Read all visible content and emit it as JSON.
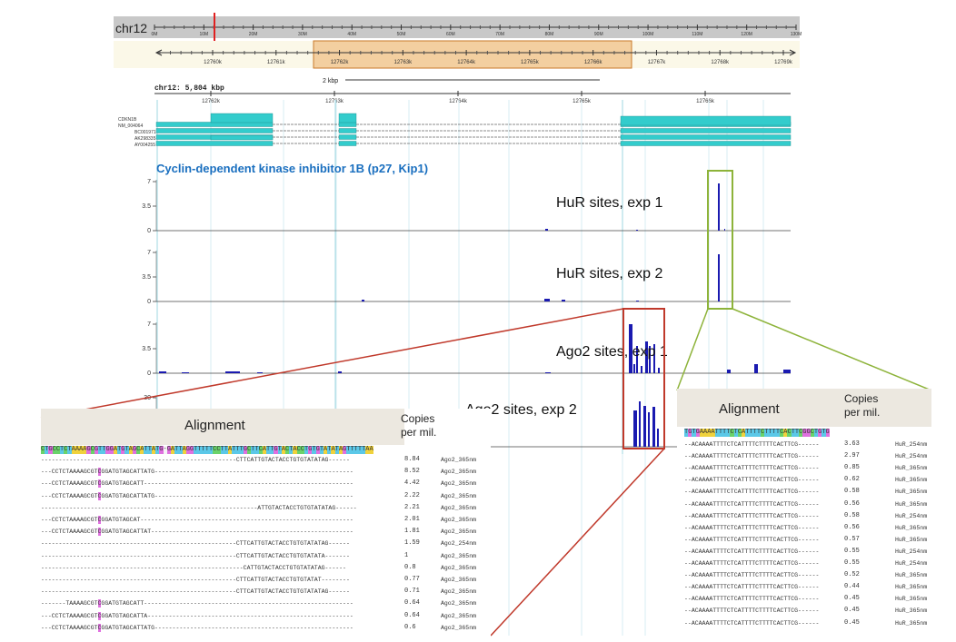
{
  "ideogram": {
    "chrom": "chr12",
    "ticks": [
      "0M",
      "10M",
      "20M",
      "30M",
      "40M",
      "50M",
      "60M",
      "70M",
      "80M",
      "90M",
      "100M",
      "110M",
      "120M",
      "130M"
    ]
  },
  "zoom_axis": {
    "ticks": [
      "12760k",
      "12761k",
      "12762k",
      "12763k",
      "12764k",
      "12765k",
      "12766k",
      "12767k",
      "12768k",
      "12769k"
    ]
  },
  "detail_axis": {
    "scale_label": "2 kbp",
    "region_label": "chr12: 5,804 kbp",
    "ticks": [
      "12762k",
      "12763k",
      "12764k",
      "12765k",
      "12766k"
    ]
  },
  "transcripts": [
    "CDKN1B",
    "NM_004064",
    "BC001971",
    "AK298335",
    "AY004255"
  ],
  "gene_title": "Cyclin-dependent kinase inhibitor 1B (p27, Kip1)",
  "tracks": [
    {
      "label": "HuR sites, exp 1",
      "ticks": [
        "7",
        "3.5",
        "0"
      ]
    },
    {
      "label": "HuR sites, exp 2",
      "ticks": [
        "7",
        "3.5",
        "0"
      ]
    },
    {
      "label": "Ago2 sites, exp 1",
      "ticks": [
        "7",
        "3.5",
        "0"
      ]
    },
    {
      "label": "Ago2 sites, exp 2",
      "ticks": [
        "30"
      ]
    }
  ],
  "left_alignment": {
    "title": "Alignment",
    "copies_label_1": "Copies",
    "copies_label_2": "per mil.",
    "reference": "CTGCCTCTAAAAGCGTTGGATGTAGCATTATG-GATTAGGTTTTTCCTTATTTGCTTCATTGTACTACCTGTGTATATAGTTTTTAA",
    "rows": [
      {
        "seq": "-------------------------------------------------------CTTCATTGTACTACCTGTGTATATAG------",
        "copies": "8.84",
        "lib": "Ago2_365nm"
      },
      {
        "seq": "---CCTCTAAAAGCGTCGGATGTAGCATTATG--------------------------------------------------------",
        "copies": "8.52",
        "lib": "Ago2_365nm"
      },
      {
        "seq": "---CCTCTAAAAGCGTCGGATGTAGCATT-----------------------------------------------------------",
        "copies": "4.42",
        "lib": "Ago2_365nm"
      },
      {
        "seq": "---CCTCTAAAAGCGTCGGATGTAGCATTATG--------------------------------------------------------",
        "copies": "2.22",
        "lib": "Ago2_365nm"
      },
      {
        "seq": "-------------------------------------------------------------ATTGTACTACCTGTGTATATAG------",
        "copies": "2.21",
        "lib": "Ago2_365nm"
      },
      {
        "seq": "---CCTCTAAAAGCGTCGGATGTAGCAT------------------------------------------------------------",
        "copies": "2.01",
        "lib": "Ago2_365nm"
      },
      {
        "seq": "---CCTCTAAAAGCGTCGGATGTAGCATTAT---------------------------------------------------------",
        "copies": "1.81",
        "lib": "Ago2_365nm"
      },
      {
        "seq": "-------------------------------------------------------CTTCATTGTACTACCTGTGTATATAG------",
        "copies": "1.59",
        "lib": "Ago2_254nm"
      },
      {
        "seq": "-------------------------------------------------------CTTCATTGTACTACCTGTGTATATA-------",
        "copies": "1",
        "lib": "Ago2_365nm"
      },
      {
        "seq": "---------------------------------------------------------CATTGTACTACCTGTGTATATAG------",
        "copies": "0.8",
        "lib": "Ago2_365nm"
      },
      {
        "seq": "-------------------------------------------------------CTTCATTGTACTACCTGTGTATAT--------",
        "copies": "0.77",
        "lib": "Ago2_365nm"
      },
      {
        "seq": "-------------------------------------------------------CTTCATTGTACTACCTGTGTATATAG------",
        "copies": "0.71",
        "lib": "Ago2_365nm"
      },
      {
        "seq": "-------TAAAAGCGTCGGATGTAGCATT-----------------------------------------------------------",
        "copies": "0.64",
        "lib": "Ago2_365nm"
      },
      {
        "seq": "---CCTCTAAAAGCGTCGGATGTAGCATTA----------------------------------------------------------",
        "copies": "0.64",
        "lib": "Ago2_365nm"
      },
      {
        "seq": "---CCTCTAAAAGCGTCGGATGTAGCATTATG--------------------------------------------------------",
        "copies": "0.6",
        "lib": "Ago2_365nm"
      }
    ]
  },
  "right_alignment": {
    "title": "Alignment",
    "copies_label_1": "Copies",
    "copies_label_2": "per mil.",
    "reference": "TGTGAAAATTTTCTCATTTTCTTTTCACTTCGGCTGTG",
    "rows": [
      {
        "seq": "--ACAAAATTTTCTCATTTTCTTTTCACTTCG------",
        "copies": "3.63",
        "lib": "HuR_254nm"
      },
      {
        "seq": "--ACAAAATTTTCTCATTTTCTTTTCACTTCG------",
        "copies": "2.97",
        "lib": "HuR_254nm"
      },
      {
        "seq": "--ACAAAATTTTCTCATTTTCTTTTCACTTCG------",
        "copies": "0.85",
        "lib": "HuR_365nm"
      },
      {
        "seq": "--ACAAAATTTTCTCATTTTCTTTTCACTTCG------",
        "copies": "0.62",
        "lib": "HuR_365nm"
      },
      {
        "seq": "--ACAAAATTTTCTCATTTTCTTTTCACTTCG------",
        "copies": "0.58",
        "lib": "HuR_365nm"
      },
      {
        "seq": "--ACAAAATTTTCTCATTTTCTTTTCACTTCG------",
        "copies": "0.56",
        "lib": "HuR_365nm"
      },
      {
        "seq": "--ACAAAATTTTCTCATTTTCTTTTCACTTCG------",
        "copies": "0.58",
        "lib": "HuR_254nm"
      },
      {
        "seq": "--ACAAAATTTTCTCATTTTCTTTTCACTTCG------",
        "copies": "0.56",
        "lib": "HuR_365nm"
      },
      {
        "seq": "--ACAAAATTTTCTCATTTTCTTTTCACTTCG------",
        "copies": "0.57",
        "lib": "HuR_365nm"
      },
      {
        "seq": "--ACAAAATTTTCTCATTTTCTTTTCACTTCG------",
        "copies": "0.55",
        "lib": "HuR_254nm"
      },
      {
        "seq": "--ACAAAATTTTCTCATTTTCTTTTCACTTCG------",
        "copies": "0.55",
        "lib": "HuR_254nm"
      },
      {
        "seq": "--ACAAAATTTTCTCATTTTCTTTTCACTTCG------",
        "copies": "0.52",
        "lib": "HuR_365nm"
      },
      {
        "seq": "--ACAAAATTTTCTCATTTTCTTTTCACTTCG------",
        "copies": "0.44",
        "lib": "HuR_365nm"
      },
      {
        "seq": "--ACAAAATTTTCTCATTTTCTTTTCACTTCG------",
        "copies": "0.45",
        "lib": "HuR_365nm"
      },
      {
        "seq": "--ACAAAATTTTCTCATTTTCTTTTCACTTCG------",
        "copies": "0.45",
        "lib": "HuR_365nm"
      },
      {
        "seq": "--ACAAAATTTTCTCATTTTCTTTTCACTTCG------",
        "copies": "0.45",
        "lib": "HuR_365nm"
      }
    ]
  },
  "colors": {
    "exon": "#33cccc",
    "signal": "#1a1ab0",
    "highlight_zoom": "#f3cfa0",
    "highlight_border": "#c87a2a",
    "title_blue": "#1a6fbf",
    "red_box": "#c0392b",
    "green_box": "#8db33a",
    "mismatch": "#e070e0",
    "ideogram_bg": "#c8c8c8"
  }
}
